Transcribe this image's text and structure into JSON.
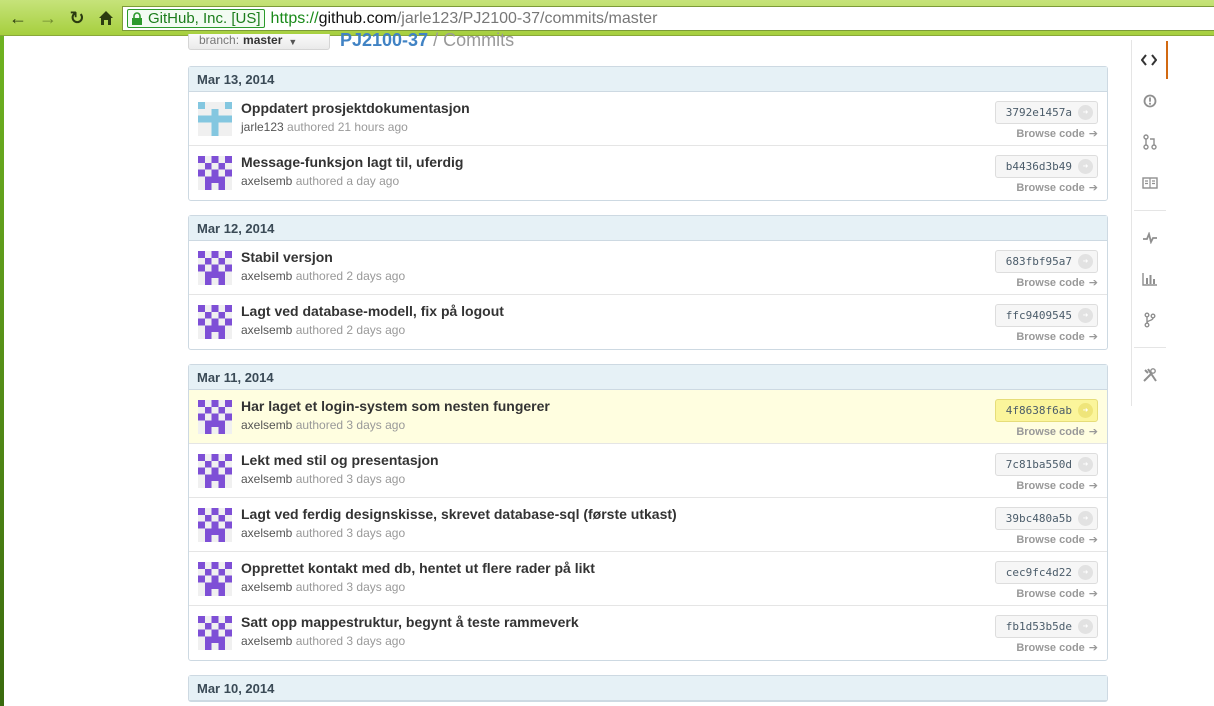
{
  "browser": {
    "ev_label": "GitHub, Inc. [US]",
    "url_scheme": "https://",
    "url_host": "github.com",
    "url_path": "/jarle123/PJ2100-37/commits/master"
  },
  "header": {
    "branch_label": "branch:",
    "branch_value": "master",
    "repo_name": "PJ2100-37",
    "separator": " / ",
    "page_title": "Commits"
  },
  "commit_groups": [
    {
      "date": "Mar 13, 2014",
      "commits": [
        {
          "message": "Oppdatert prosjektdokumentasjon",
          "author": "jarle123",
          "time": "authored 21 hours ago",
          "sha": "3792e1457a",
          "browse": "Browse code",
          "avatar": "jarle123"
        },
        {
          "message": "Message-funksjon lagt til, uferdig",
          "author": "axelsemb",
          "time": "authored a day ago",
          "sha": "b4436d3b49",
          "browse": "Browse code",
          "avatar": "axelsemb"
        }
      ]
    },
    {
      "date": "Mar 12, 2014",
      "commits": [
        {
          "message": "Stabil versjon",
          "author": "axelsemb",
          "time": "authored 2 days ago",
          "sha": "683fbf95a7",
          "browse": "Browse code",
          "avatar": "axelsemb"
        },
        {
          "message": "Lagt ved database-modell, fix på logout",
          "author": "axelsemb",
          "time": "authored 2 days ago",
          "sha": "ffc9409545",
          "browse": "Browse code",
          "avatar": "axelsemb"
        }
      ]
    },
    {
      "date": "Mar 11, 2014",
      "commits": [
        {
          "message": "Har laget et login-system som nesten fungerer",
          "author": "axelsemb",
          "time": "authored 3 days ago",
          "sha": "4f8638f6ab",
          "browse": "Browse code",
          "avatar": "axelsemb",
          "highlighted": true
        },
        {
          "message": "Lekt med stil og presentasjon",
          "author": "axelsemb",
          "time": "authored 3 days ago",
          "sha": "7c81ba550d",
          "browse": "Browse code",
          "avatar": "axelsemb"
        },
        {
          "message": "Lagt ved ferdig designskisse, skrevet database-sql (første utkast)",
          "author": "axelsemb",
          "time": "authored 3 days ago",
          "sha": "39bc480a5b",
          "browse": "Browse code",
          "avatar": "axelsemb"
        },
        {
          "message": "Opprettet kontakt med db, hentet ut flere rader på likt",
          "author": "axelsemb",
          "time": "authored 3 days ago",
          "sha": "cec9fc4d22",
          "browse": "Browse code",
          "avatar": "axelsemb"
        },
        {
          "message": "Satt opp mappestruktur, begynt å teste rammeverk",
          "author": "axelsemb",
          "time": "authored 3 days ago",
          "sha": "fb1d53b5de",
          "browse": "Browse code",
          "avatar": "axelsemb"
        }
      ]
    },
    {
      "date": "Mar 10, 2014",
      "commits": []
    }
  ],
  "repo_nav": [
    {
      "icon": "code-icon",
      "active": true
    },
    {
      "icon": "issues-icon"
    },
    {
      "icon": "pull-requests-icon"
    },
    {
      "icon": "wiki-icon"
    },
    {
      "icon": "pulse-icon"
    },
    {
      "icon": "graphs-icon"
    },
    {
      "icon": "network-icon"
    },
    {
      "icon": "settings-icon"
    }
  ],
  "colors": {
    "browser_chrome": "#a6cf3e",
    "group_header": "#e6f1f6",
    "highlight_row": "#fffee0",
    "avatar_purple": "#7e4fd6",
    "avatar_blue": "#84c7e0",
    "link_blue": "#4183c4",
    "nav_active_border": "#d26911"
  }
}
